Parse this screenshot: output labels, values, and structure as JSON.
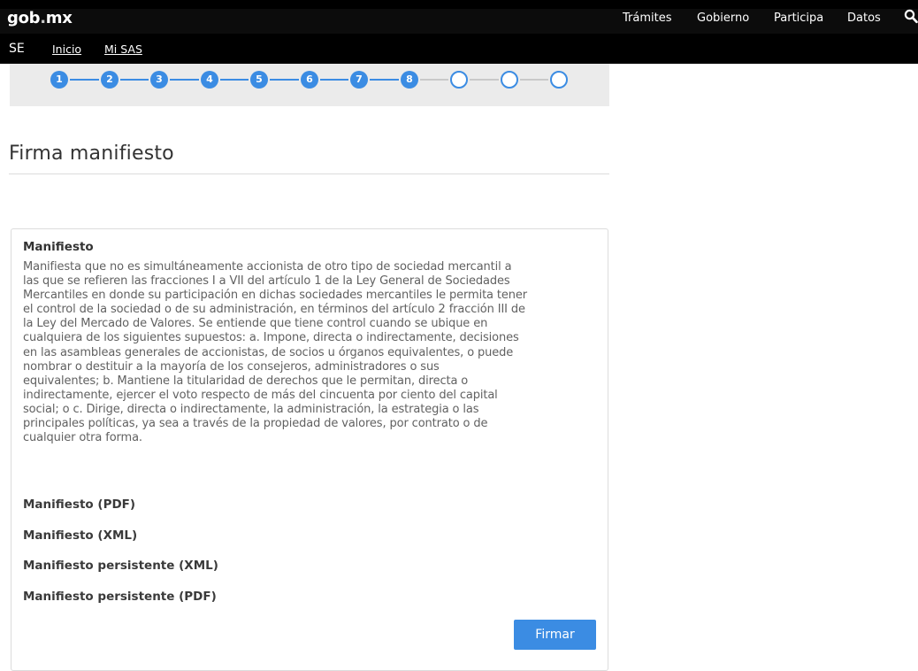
{
  "header": {
    "logo": "gob.mx",
    "logo_main": "gob",
    "logo_dot": ".",
    "logo_tail": "mx",
    "nav": [
      "Trámites",
      "Gobierno",
      "Participa",
      "Datos"
    ],
    "search_icon": "search-icon"
  },
  "subnav": {
    "section": "SE",
    "links": [
      "Inicio",
      "Mi SAS"
    ]
  },
  "stepper": {
    "steps": [
      "1",
      "2",
      "3",
      "4",
      "5",
      "6",
      "7",
      "8",
      "",
      "",
      ""
    ],
    "completed": 8,
    "total": 11,
    "accent_color": "#3b8ce3"
  },
  "page": {
    "title": "Firma manifiesto"
  },
  "manifest": {
    "heading": "Manifiesto",
    "body": "Manifiesta que no es simultáneamente accionista de otro tipo de sociedad mercantil a\nlas que se refieren las fracciones I a VII del artículo 1 de la Ley General de Sociedades\nMercantiles en donde su participación en dichas sociedades mercantiles le permita tener\nel control de la sociedad o de su administración, en términos del artículo 2 fracción III de\nla Ley del Mercado de Valores. Se entiende que tiene control cuando se ubique en\ncualquiera de los siguientes supuestos:  a. Impone, directa o indirectamente, decisiones\nen las asambleas generales de accionistas, de socios u órganos equivalentes, o puede\nnombrar o destituir a la mayoría de los consejeros, administradores o sus\nequivalentes;    b. Mantiene la titularidad de derechos que le permitan, directa o\nindirectamente, ejercer el voto respecto de más del cincuenta por ciento del capital\nsocial; o    c. Dirige, directa o indirectamente, la administración, la estrategia o las\nprincipales políticas, ya sea a través de la propiedad de valores, por contrato o de\ncualquier otra forma.",
    "documents": [
      "Manifiesto (PDF)",
      "Manifiesto (XML)",
      "Manifiesto persistente (XML)",
      "Manifiesto persistente (PDF)"
    ],
    "sign_button": "Firmar"
  }
}
